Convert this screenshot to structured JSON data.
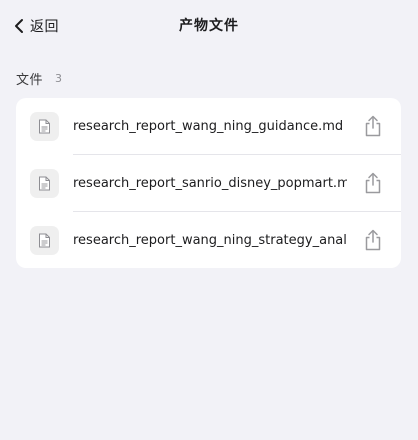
{
  "nav": {
    "back_label": "返回",
    "title": "产物文件"
  },
  "section": {
    "title": "文件",
    "count": "3"
  },
  "files": [
    {
      "name": "research_report_wang_ning_guidance.md",
      "icon": "document-icon",
      "action_icon": "share-icon"
    },
    {
      "name": "research_report_sanrio_disney_popmart.md",
      "icon": "document-icon",
      "action_icon": "share-icon"
    },
    {
      "name": "research_report_wang_ning_strategy_analysis.md",
      "icon": "document-icon",
      "action_icon": "share-icon"
    }
  ],
  "colors": {
    "background": "#f2f2f7",
    "card": "#ffffff",
    "icon_gray": "#9a9a9e"
  }
}
